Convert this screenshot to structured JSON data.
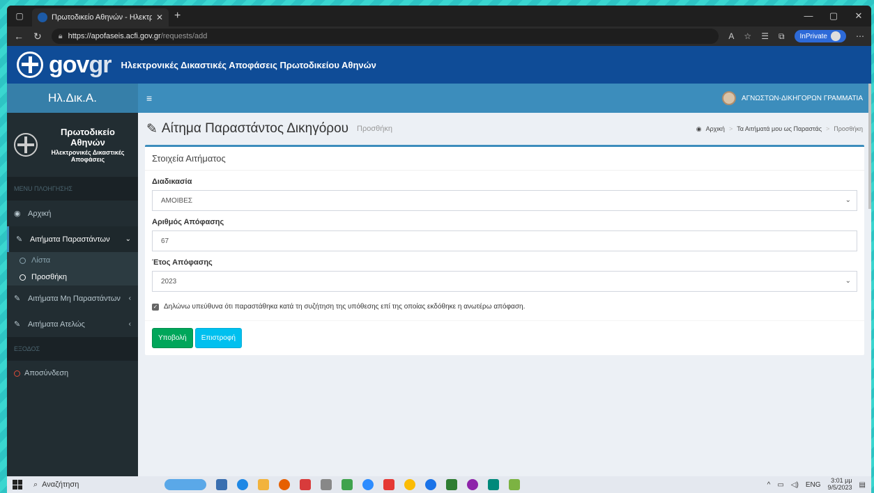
{
  "browser": {
    "tab_title": "Πρωτοδικείο Αθηνών - Ηλεκτρο",
    "url_host": "https://apofaseis.acfi.gov.gr",
    "url_path": "/requests/add",
    "inprivate_label": "InPrivate"
  },
  "gov": {
    "logo_main": "gov",
    "logo_gr": "gr",
    "title": "Ηλεκτρονικές Δικαστικές Αποφάσεις Πρωτοδικείου Αθηνών"
  },
  "sidebar": {
    "brand": "Ηλ.Δικ.Α.",
    "org_name": "Πρωτοδικείο Αθηνών",
    "org_sub": "Ηλεκτρονικές Δικαστικές Αποφάσεις",
    "menu_header": "MENU ΠΛΟΗΓΗΣΗΣ",
    "home": "Αρχική",
    "requests_present": "Αιτήματα Παραστάντων",
    "sub_list": "Λίστα",
    "sub_add": "Προσθήκη",
    "requests_not_present": "Αιτήματα Μη Παραστάντων",
    "requests_free": "Αιτήματα Ατελώς",
    "exit_header": "ΕΞΟΔΟΣ",
    "logout": "Αποσύνδεση"
  },
  "topnav": {
    "user": "ΑΓΝΩΣΤΩΝ-ΔΙΚΗΓΟΡΩΝ ΓΡΑΜΜΑΤΙΑ"
  },
  "header": {
    "title": "Αίτημα Παραστάντος Δικηγόρου",
    "subtitle": "Προσθήκη",
    "crumb_home": "Αρχική",
    "crumb_mid": "Τα Αιτήματά μου ως Παραστάς",
    "crumb_last": "Προσθήκη"
  },
  "form": {
    "box_title": "Στοιχεία Αιτήματος",
    "procedure_label": "Διαδικασία",
    "procedure_value": "ΑΜΟΙΒΕΣ",
    "decision_no_label": "Αριθμός Απόφασης",
    "decision_no_value": "67",
    "year_label": "Έτος Απόφασης",
    "year_value": "2023",
    "declaration": "Δηλώνω υπεύθυνα ότι παραστάθηκα κατά τη συζήτηση της υπόθεσης επί της οποίας εκδόθηκε η ανωτέρω απόφαση.",
    "submit": "Υποβολή",
    "back": "Επιστροφή"
  },
  "taskbar": {
    "search": "Αναζήτηση",
    "lang": "ENG",
    "time": "3:01 μμ",
    "date": "9/5/2023"
  }
}
